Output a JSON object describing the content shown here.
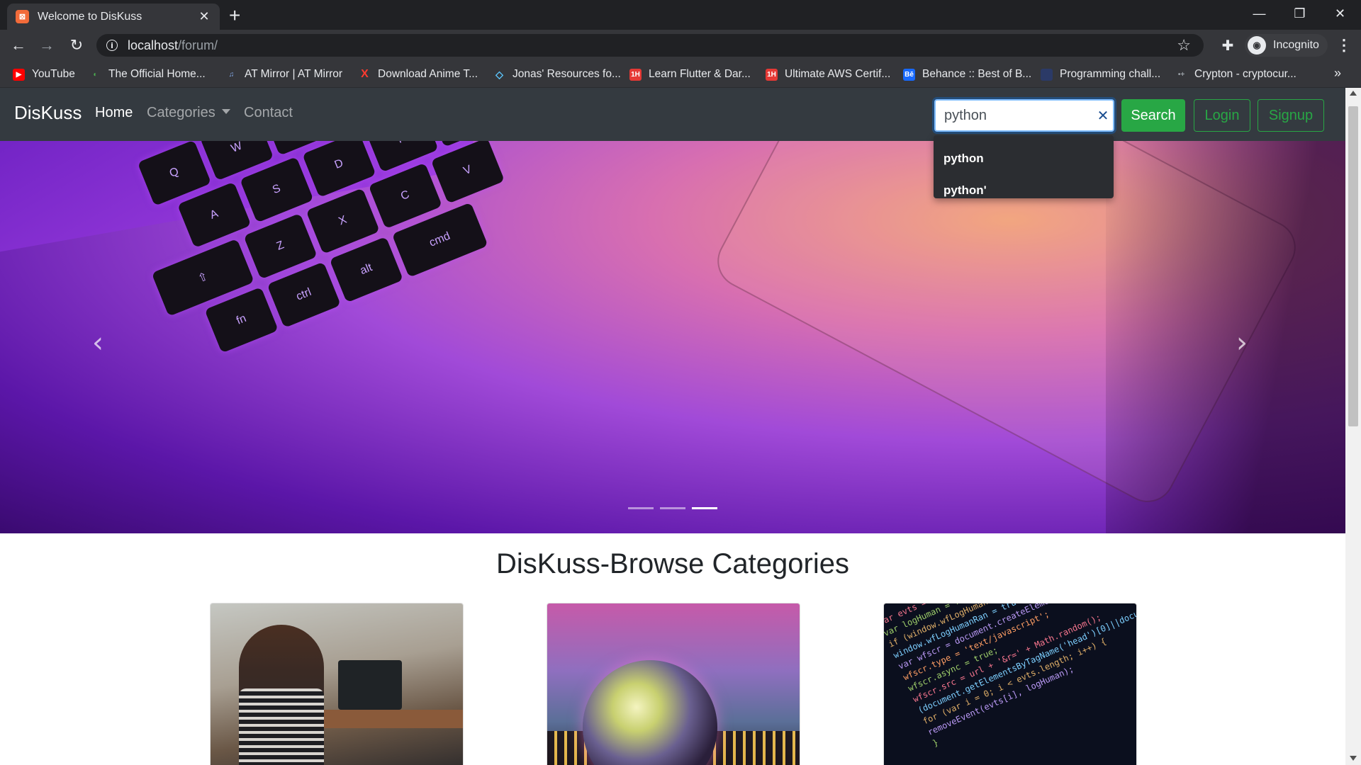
{
  "browser": {
    "tab_title": "Welcome to DisKuss",
    "url_host": "localhost",
    "url_path": "/forum/",
    "profile_label": "Incognito",
    "bookmarks": [
      {
        "label": "YouTube",
        "color": "#ff0000",
        "icon": "youtube-icon"
      },
      {
        "label": "The Official Home...",
        "color": "#4caf50",
        "icon": "leaf-icon"
      },
      {
        "label": "AT Mirror | AT Mirror",
        "color": "#8ab4f8",
        "icon": "mirror-icon"
      },
      {
        "label": "Download Anime T...",
        "color": "#ff3b30",
        "icon": "x-icon"
      },
      {
        "label": "Jonas' Resources fo...",
        "color": "#5cc8ff",
        "icon": "diamond-icon"
      },
      {
        "label": "Learn Flutter & Dar...",
        "color": "#e53935",
        "icon": "1h-icon"
      },
      {
        "label": "Ultimate AWS Certif...",
        "color": "#e53935",
        "icon": "1h-icon"
      },
      {
        "label": "Behance :: Best of B...",
        "color": "#1769ff",
        "icon": "behance-icon"
      },
      {
        "label": "Programming chall...",
        "color": "#2b3a67",
        "icon": "square-icon"
      },
      {
        "label": "Crypton - cryptocur...",
        "color": "#9aa0a6",
        "icon": "crypton-icon"
      }
    ]
  },
  "navbar": {
    "brand": "DisKuss",
    "links": {
      "home": "Home",
      "categories": "Categories",
      "contact": "Contact"
    },
    "search_value": "python",
    "search_button": "Search",
    "login_button": "Login",
    "signup_button": "Signup",
    "suggestions": [
      "python",
      "python'"
    ]
  },
  "carousel": {
    "slide_count": 3,
    "active_slide": 3
  },
  "categories": {
    "heading": "DisKuss-Browse Categories"
  },
  "colors": {
    "navbar_bg": "#343a40",
    "success": "#28a745"
  }
}
